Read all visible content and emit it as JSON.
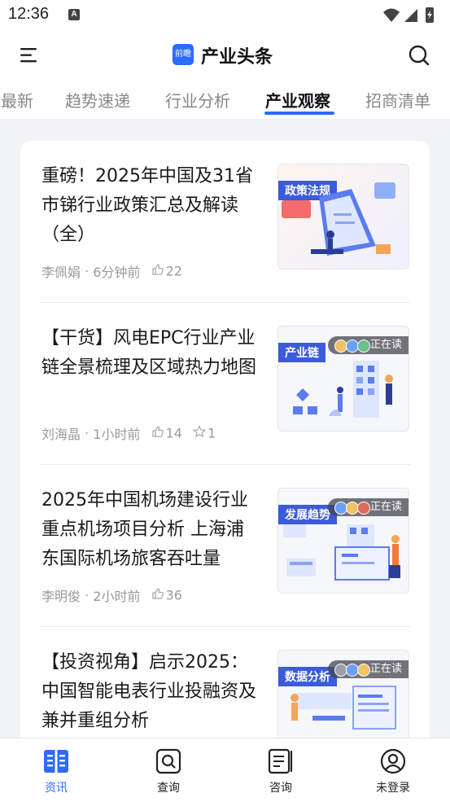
{
  "status": {
    "time": "12:36",
    "notif_icon": "A"
  },
  "header": {
    "logo_text": "前瞻",
    "title": "产业头条"
  },
  "tabs": [
    "最新",
    "趋势速递",
    "行业分析",
    "产业观察",
    "招商清单"
  ],
  "active_tab": "产业观察",
  "articles": [
    {
      "title": "重磅！2025年中国及31省市锑行业政策汇总及解读（全）",
      "author": "李佩娟",
      "time": "6分钟前",
      "likes": "22",
      "stars": "",
      "thumb_label": "政策法规",
      "reading": "",
      "thumb_color": "#e8eefc"
    },
    {
      "title": "【干货】风电EPC行业产业链全景梳理及区域热力地图",
      "author": "刘海晶",
      "time": "1小时前",
      "likes": "14",
      "stars": "1",
      "thumb_label": "产业链",
      "reading": "正在读",
      "thumb_color": "#eef2fb"
    },
    {
      "title": "2025年中国机场建设行业重点机场项目分析 上海浦东国际机场旅客吞吐量",
      "author": "李明俊",
      "time": "2小时前",
      "likes": "36",
      "stars": "",
      "thumb_label": "发展趋势",
      "reading": "正在读",
      "thumb_color": "#eef2fb"
    },
    {
      "title": "【投资视角】启示2025：中国智能电表行业投融资及兼并重组分析",
      "author": "",
      "time": "",
      "likes": "",
      "stars": "",
      "thumb_label": "数据分析",
      "reading": "正在读",
      "thumb_color": "#eef2fb"
    }
  ],
  "meta_sep": " · ",
  "bottom_nav": [
    {
      "label": "资讯",
      "icon": "news-icon",
      "active": true
    },
    {
      "label": "查询",
      "icon": "search-box-icon",
      "active": false
    },
    {
      "label": "咨询",
      "icon": "document-icon",
      "active": false
    },
    {
      "label": "未登录",
      "icon": "user-icon",
      "active": false
    }
  ],
  "colors": {
    "accent": "#2c6cf6",
    "label_bg": "#3b5bdb"
  }
}
